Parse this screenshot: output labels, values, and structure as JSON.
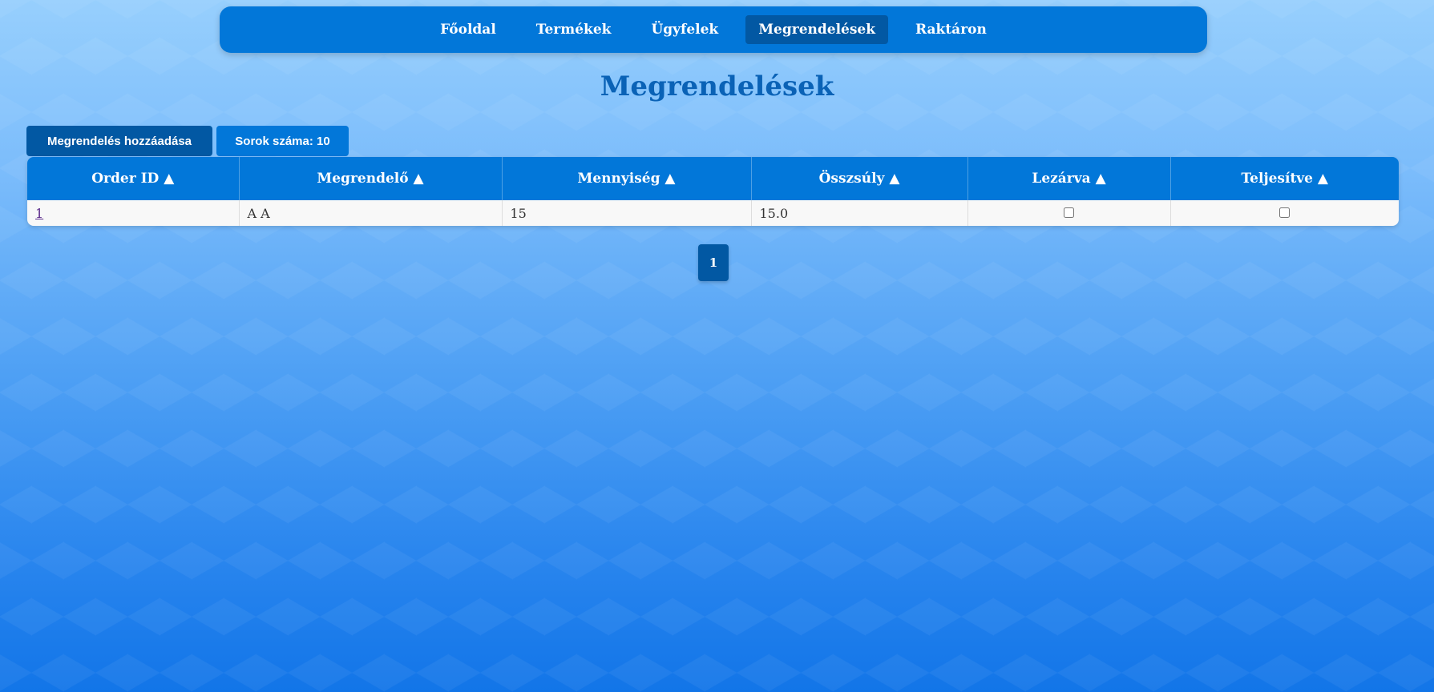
{
  "nav": {
    "items": [
      {
        "label": "Főoldal"
      },
      {
        "label": "Termékek"
      },
      {
        "label": "Ügyfelek"
      },
      {
        "label": "Megrendelések",
        "active": true
      },
      {
        "label": "Raktáron"
      }
    ]
  },
  "page": {
    "title": "Megrendelések"
  },
  "toolbar": {
    "add_label": "Megrendelés hozzáadása",
    "rows_label": "Sorok száma: 10"
  },
  "table": {
    "headers": [
      "Order ID ▲",
      "Megrendelő ▲",
      "Mennyiség ▲",
      "Összsúly ▲",
      "Lezárva ▲",
      "Teljesítve ▲"
    ],
    "rows": [
      {
        "order_id": "1",
        "customer": "A A",
        "quantity": "15",
        "total_weight": "15.0",
        "closed": false,
        "completed": false
      }
    ]
  },
  "pagination": {
    "current": "1"
  },
  "colors": {
    "primary": "#0277d9",
    "primary_dark": "#0258a3",
    "title": "#0a62b6"
  }
}
